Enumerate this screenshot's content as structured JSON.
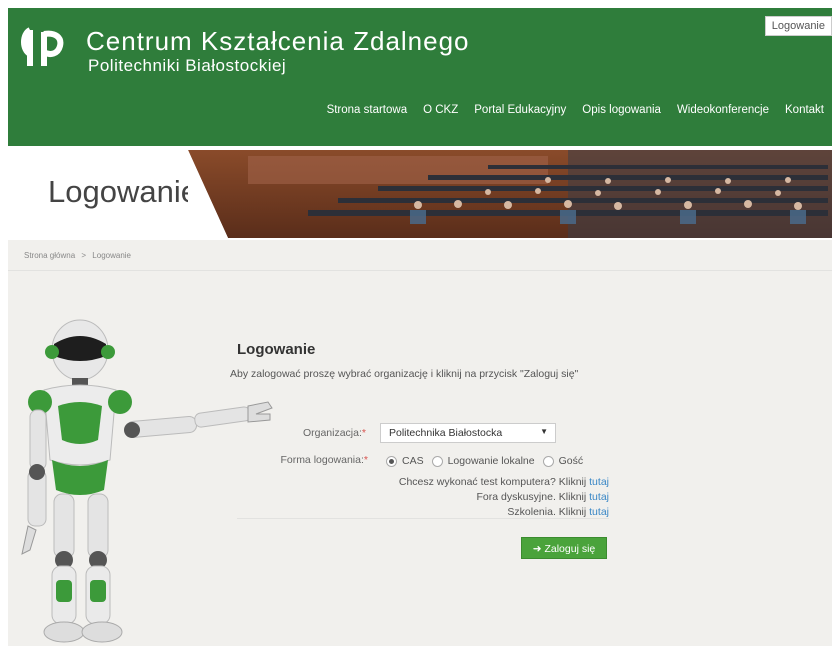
{
  "header": {
    "title_line1": "Centrum Kształcenia Zdalnego",
    "title_line2": "Politechniki Białostockiej",
    "login_link": "Logowanie",
    "nav": [
      "Strona startowa",
      "O CKZ",
      "Portal Edukacyjny",
      "Opis logowania",
      "Wideokonferencje",
      "Kontakt"
    ]
  },
  "banner": {
    "title": "Logowanie"
  },
  "breadcrumb": {
    "home": "Strona główna",
    "sep": ">",
    "current": "Logowanie"
  },
  "form": {
    "title": "Logowanie",
    "intro": "Aby zalogować proszę wybrać organizację i kliknij na przycisk \"Zaloguj się\"",
    "org_label": "Organizacja:",
    "org_value": "Politechnika Białostocka",
    "method_label": "Forma logowania:",
    "required_mark": "*",
    "methods": [
      "CAS",
      "Logowanie lokalne",
      "Gość"
    ],
    "selected_method": "CAS",
    "info_rows": [
      {
        "text": "Chcesz wykonać test komputera? Kliknij",
        "link": "tutaj"
      },
      {
        "text": "Fora dyskusyjne. Kliknij",
        "link": "tutaj"
      },
      {
        "text": "Szkolenia. Kliknij",
        "link": "tutaj"
      }
    ],
    "submit_label": "Zaloguj się",
    "submit_icon": "arrow-right-icon"
  },
  "colors": {
    "brand_green": "#2f7d3b",
    "button_green": "#4aa33b",
    "link_blue": "#3a87c6",
    "content_bg": "#f1f0ed"
  }
}
